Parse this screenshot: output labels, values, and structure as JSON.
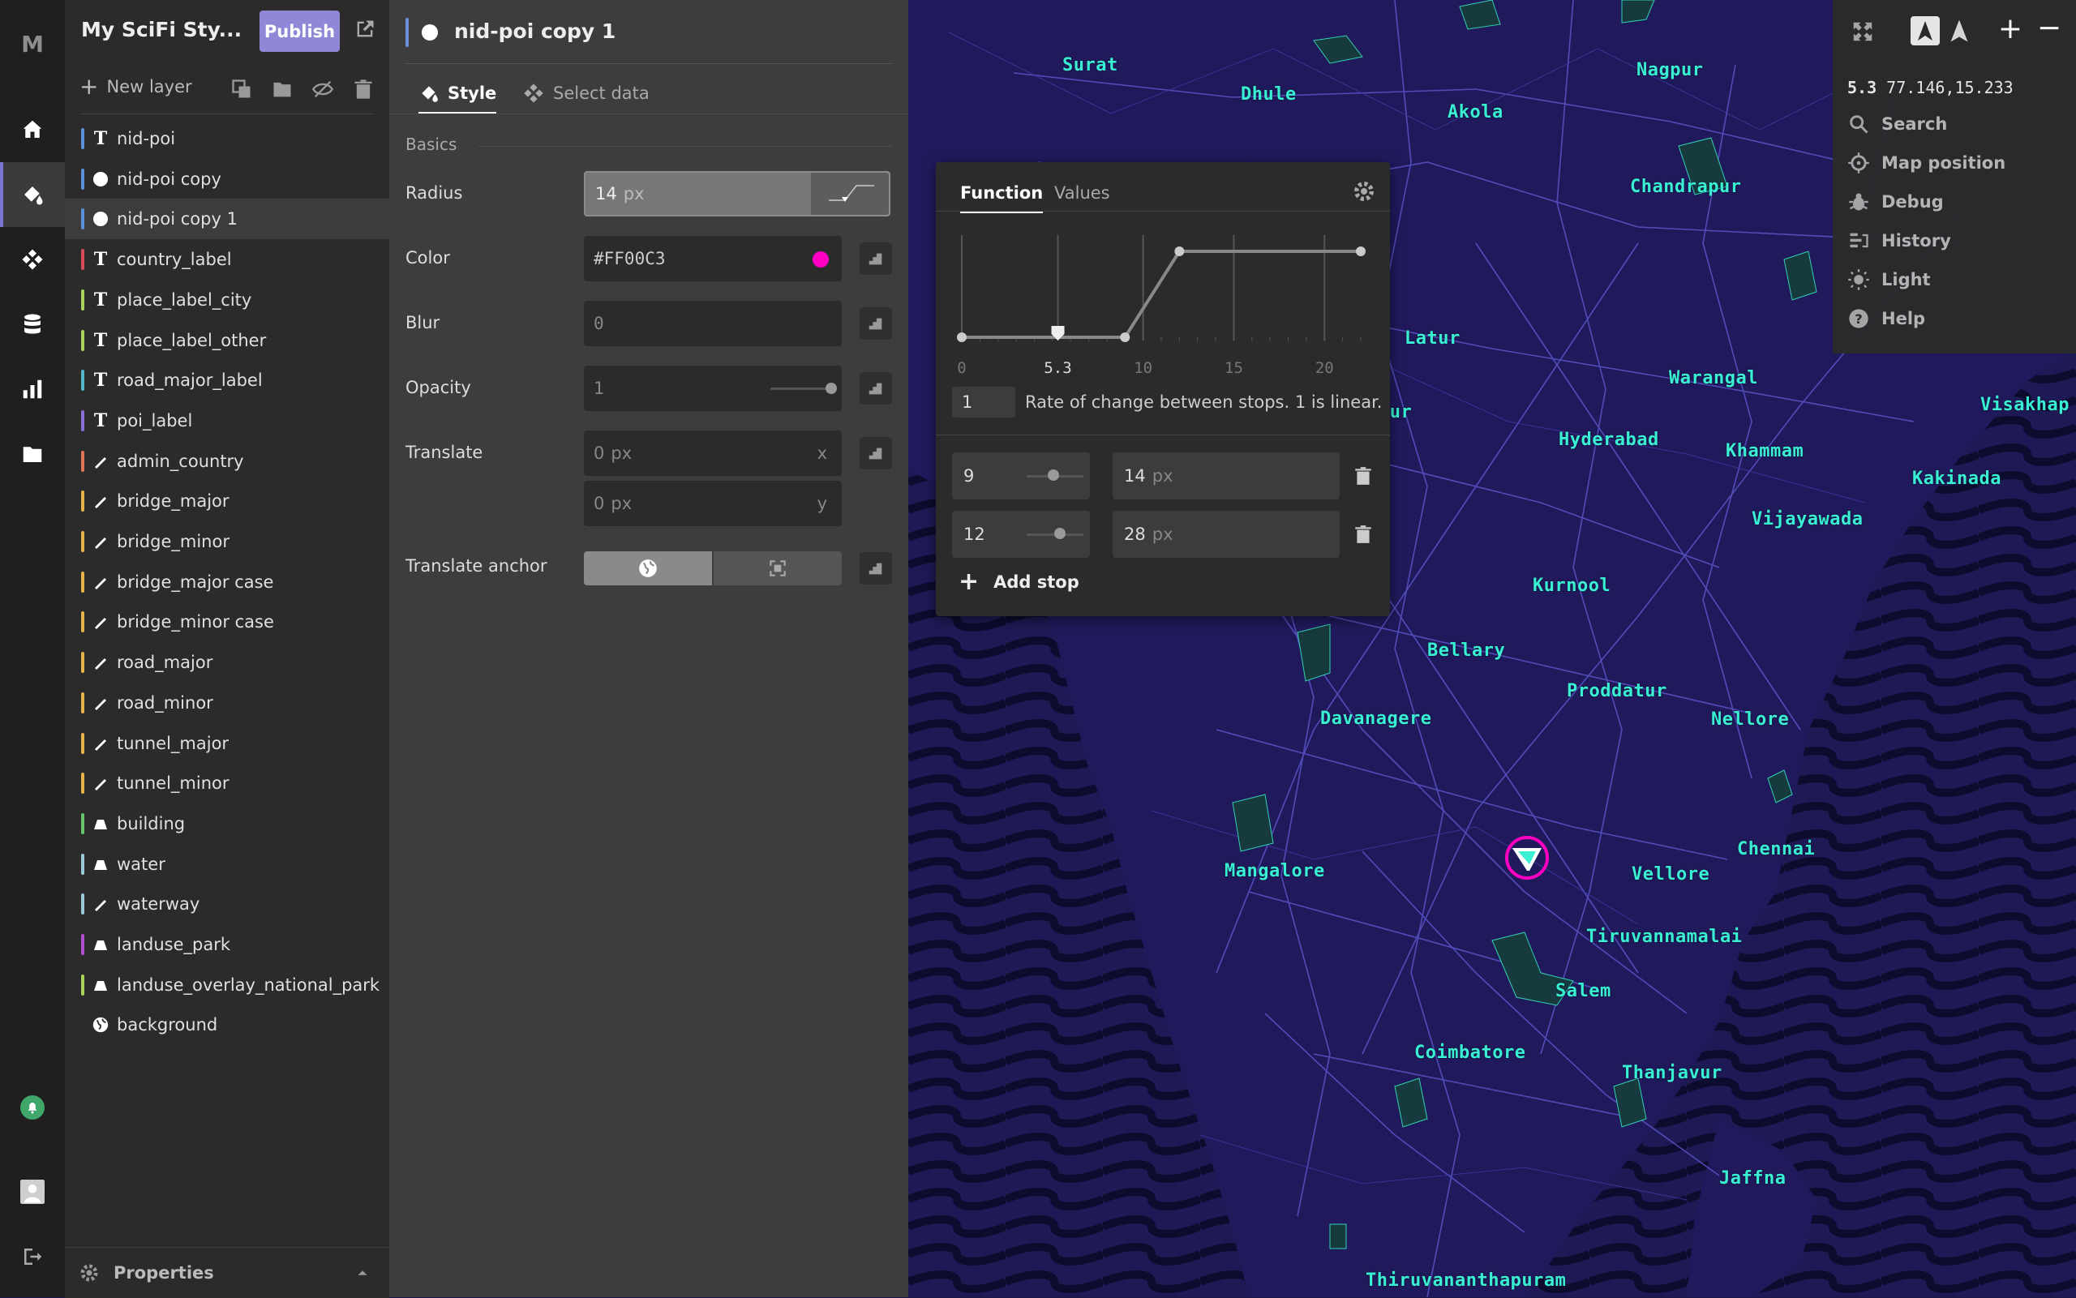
{
  "app": {
    "logo": "M",
    "style_name": "My SciFi Sty...",
    "publish_label": "Publish"
  },
  "layer_panel": {
    "new_layer_label": "New layer",
    "properties_label": "Properties",
    "layers": [
      {
        "name": "nid-poi",
        "type": "symbol",
        "color": "#5b8fd9"
      },
      {
        "name": "nid-poi copy",
        "type": "circle",
        "color": "#5b8fd9"
      },
      {
        "name": "nid-poi copy 1",
        "type": "circle",
        "color": "#5b8fd9",
        "selected": true
      },
      {
        "name": "country_label",
        "type": "symbol",
        "color": "#d94c5a"
      },
      {
        "name": "place_label_city",
        "type": "symbol",
        "color": "#a9d35a"
      },
      {
        "name": "place_label_other",
        "type": "symbol",
        "color": "#a9d35a"
      },
      {
        "name": "road_major_label",
        "type": "symbol",
        "color": "#56b6c9"
      },
      {
        "name": "poi_label",
        "type": "symbol",
        "color": "#8a6fd8"
      },
      {
        "name": "admin_country",
        "type": "line",
        "color": "#e0745a"
      },
      {
        "name": "bridge_major",
        "type": "line",
        "color": "#e8b24a"
      },
      {
        "name": "bridge_minor",
        "type": "line",
        "color": "#e8b24a"
      },
      {
        "name": "bridge_major case",
        "type": "line",
        "color": "#e8b24a"
      },
      {
        "name": "bridge_minor case",
        "type": "line",
        "color": "#e8b24a"
      },
      {
        "name": "road_major",
        "type": "line",
        "color": "#e8b24a"
      },
      {
        "name": "road_minor",
        "type": "line",
        "color": "#e8b24a"
      },
      {
        "name": "tunnel_major",
        "type": "line",
        "color": "#e8b24a"
      },
      {
        "name": "tunnel_minor",
        "type": "line",
        "color": "#e8b24a"
      },
      {
        "name": "building",
        "type": "fill",
        "color": "#66c46b"
      },
      {
        "name": "water",
        "type": "fill",
        "color": "#9cc9d8"
      },
      {
        "name": "waterway",
        "type": "line",
        "color": "#9cc9d8"
      },
      {
        "name": "landuse_park",
        "type": "fill",
        "color": "#b04fcf"
      },
      {
        "name": "landuse_overlay_national_park",
        "type": "fill",
        "color": "#a9d35a"
      },
      {
        "name": "background",
        "type": "background",
        "color": ""
      }
    ]
  },
  "editor": {
    "layer_title": "nid-poi copy 1",
    "tabs": {
      "style": "Style",
      "select_data": "Select data"
    },
    "section": "Basics",
    "radius": {
      "label": "Radius",
      "value": "14",
      "unit": "px"
    },
    "color": {
      "label": "Color",
      "value": "#FF00C3",
      "swatch": "#FF00C3"
    },
    "blur": {
      "label": "Blur",
      "value": "0"
    },
    "opacity": {
      "label": "Opacity",
      "value": "1"
    },
    "translate": {
      "label": "Translate",
      "x_value": "0",
      "y_value": "0",
      "unit": "px",
      "x_axis": "x",
      "y_axis": "y"
    },
    "translate_anchor": {
      "label": "Translate anchor",
      "selected": "map"
    }
  },
  "function_popup": {
    "tabs": {
      "function": "Function",
      "values": "Values"
    },
    "chart_ticks": [
      "0",
      "5.3",
      "10",
      "15",
      "20"
    ],
    "current_zoom": 5.3,
    "base": {
      "value": "1",
      "description": "Rate of change between stops. 1 is linear."
    },
    "stops": [
      {
        "zoom": "9",
        "value": "14",
        "unit": "px"
      },
      {
        "zoom": "12",
        "value": "28",
        "unit": "px"
      }
    ],
    "add_stop_label": "Add stop"
  },
  "map_controls": {
    "position_readout_zoom": "5.3",
    "position_readout_coords": "77.146,15.233",
    "items": [
      "Search",
      "Map position",
      "Debug",
      "History",
      "Light",
      "Help"
    ]
  },
  "map": {
    "cities": [
      "Surat",
      "Dhule",
      "Nagpur",
      "Akola",
      "Chandrapur",
      "Latur",
      "Warangal",
      "Visakhap",
      "Hyderabad",
      "Khammam",
      "Kakinada",
      "our",
      "Vijayawada",
      "Kurnool",
      "Bellary",
      "Proddatur",
      "Nellore",
      "Davanagere",
      "Chennai",
      "Mangalore",
      "Vellore",
      "Tiruvannamalai",
      "Salem",
      "Coimbatore",
      "Thanjavur",
      "Jaffna",
      "Thiruvananthapuram"
    ]
  },
  "colors": {
    "accent": "#8e88d6",
    "map_background": "#1b1750",
    "city_label": "#3af0d2",
    "poi_marker": "#FF00C3"
  }
}
